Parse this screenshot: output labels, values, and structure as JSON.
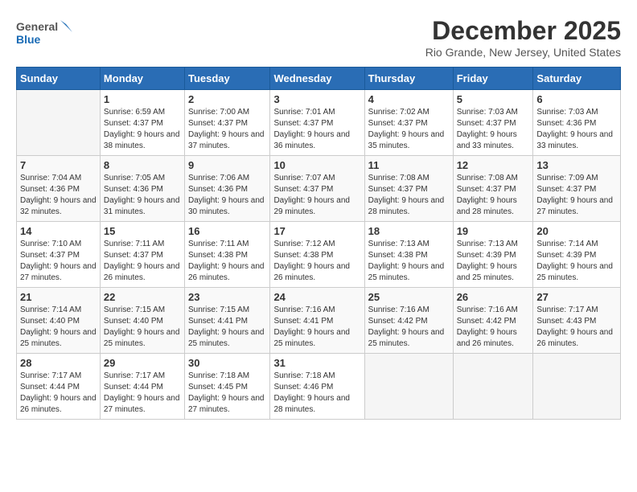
{
  "header": {
    "logo_general": "General",
    "logo_blue": "Blue",
    "month_title": "December 2025",
    "location": "Rio Grande, New Jersey, United States"
  },
  "days_of_week": [
    "Sunday",
    "Monday",
    "Tuesday",
    "Wednesday",
    "Thursday",
    "Friday",
    "Saturday"
  ],
  "weeks": [
    [
      {
        "day": "",
        "sunrise": "",
        "sunset": "",
        "daylight": ""
      },
      {
        "day": "1",
        "sunrise": "Sunrise: 6:59 AM",
        "sunset": "Sunset: 4:37 PM",
        "daylight": "Daylight: 9 hours and 38 minutes."
      },
      {
        "day": "2",
        "sunrise": "Sunrise: 7:00 AM",
        "sunset": "Sunset: 4:37 PM",
        "daylight": "Daylight: 9 hours and 37 minutes."
      },
      {
        "day": "3",
        "sunrise": "Sunrise: 7:01 AM",
        "sunset": "Sunset: 4:37 PM",
        "daylight": "Daylight: 9 hours and 36 minutes."
      },
      {
        "day": "4",
        "sunrise": "Sunrise: 7:02 AM",
        "sunset": "Sunset: 4:37 PM",
        "daylight": "Daylight: 9 hours and 35 minutes."
      },
      {
        "day": "5",
        "sunrise": "Sunrise: 7:03 AM",
        "sunset": "Sunset: 4:37 PM",
        "daylight": "Daylight: 9 hours and 33 minutes."
      },
      {
        "day": "6",
        "sunrise": "Sunrise: 7:03 AM",
        "sunset": "Sunset: 4:36 PM",
        "daylight": "Daylight: 9 hours and 33 minutes."
      }
    ],
    [
      {
        "day": "7",
        "sunrise": "Sunrise: 7:04 AM",
        "sunset": "Sunset: 4:36 PM",
        "daylight": "Daylight: 9 hours and 32 minutes."
      },
      {
        "day": "8",
        "sunrise": "Sunrise: 7:05 AM",
        "sunset": "Sunset: 4:36 PM",
        "daylight": "Daylight: 9 hours and 31 minutes."
      },
      {
        "day": "9",
        "sunrise": "Sunrise: 7:06 AM",
        "sunset": "Sunset: 4:36 PM",
        "daylight": "Daylight: 9 hours and 30 minutes."
      },
      {
        "day": "10",
        "sunrise": "Sunrise: 7:07 AM",
        "sunset": "Sunset: 4:37 PM",
        "daylight": "Daylight: 9 hours and 29 minutes."
      },
      {
        "day": "11",
        "sunrise": "Sunrise: 7:08 AM",
        "sunset": "Sunset: 4:37 PM",
        "daylight": "Daylight: 9 hours and 28 minutes."
      },
      {
        "day": "12",
        "sunrise": "Sunrise: 7:08 AM",
        "sunset": "Sunset: 4:37 PM",
        "daylight": "Daylight: 9 hours and 28 minutes."
      },
      {
        "day": "13",
        "sunrise": "Sunrise: 7:09 AM",
        "sunset": "Sunset: 4:37 PM",
        "daylight": "Daylight: 9 hours and 27 minutes."
      }
    ],
    [
      {
        "day": "14",
        "sunrise": "Sunrise: 7:10 AM",
        "sunset": "Sunset: 4:37 PM",
        "daylight": "Daylight: 9 hours and 27 minutes."
      },
      {
        "day": "15",
        "sunrise": "Sunrise: 7:11 AM",
        "sunset": "Sunset: 4:37 PM",
        "daylight": "Daylight: 9 hours and 26 minutes."
      },
      {
        "day": "16",
        "sunrise": "Sunrise: 7:11 AM",
        "sunset": "Sunset: 4:38 PM",
        "daylight": "Daylight: 9 hours and 26 minutes."
      },
      {
        "day": "17",
        "sunrise": "Sunrise: 7:12 AM",
        "sunset": "Sunset: 4:38 PM",
        "daylight": "Daylight: 9 hours and 26 minutes."
      },
      {
        "day": "18",
        "sunrise": "Sunrise: 7:13 AM",
        "sunset": "Sunset: 4:38 PM",
        "daylight": "Daylight: 9 hours and 25 minutes."
      },
      {
        "day": "19",
        "sunrise": "Sunrise: 7:13 AM",
        "sunset": "Sunset: 4:39 PM",
        "daylight": "Daylight: 9 hours and 25 minutes."
      },
      {
        "day": "20",
        "sunrise": "Sunrise: 7:14 AM",
        "sunset": "Sunset: 4:39 PM",
        "daylight": "Daylight: 9 hours and 25 minutes."
      }
    ],
    [
      {
        "day": "21",
        "sunrise": "Sunrise: 7:14 AM",
        "sunset": "Sunset: 4:40 PM",
        "daylight": "Daylight: 9 hours and 25 minutes."
      },
      {
        "day": "22",
        "sunrise": "Sunrise: 7:15 AM",
        "sunset": "Sunset: 4:40 PM",
        "daylight": "Daylight: 9 hours and 25 minutes."
      },
      {
        "day": "23",
        "sunrise": "Sunrise: 7:15 AM",
        "sunset": "Sunset: 4:41 PM",
        "daylight": "Daylight: 9 hours and 25 minutes."
      },
      {
        "day": "24",
        "sunrise": "Sunrise: 7:16 AM",
        "sunset": "Sunset: 4:41 PM",
        "daylight": "Daylight: 9 hours and 25 minutes."
      },
      {
        "day": "25",
        "sunrise": "Sunrise: 7:16 AM",
        "sunset": "Sunset: 4:42 PM",
        "daylight": "Daylight: 9 hours and 25 minutes."
      },
      {
        "day": "26",
        "sunrise": "Sunrise: 7:16 AM",
        "sunset": "Sunset: 4:42 PM",
        "daylight": "Daylight: 9 hours and 26 minutes."
      },
      {
        "day": "27",
        "sunrise": "Sunrise: 7:17 AM",
        "sunset": "Sunset: 4:43 PM",
        "daylight": "Daylight: 9 hours and 26 minutes."
      }
    ],
    [
      {
        "day": "28",
        "sunrise": "Sunrise: 7:17 AM",
        "sunset": "Sunset: 4:44 PM",
        "daylight": "Daylight: 9 hours and 26 minutes."
      },
      {
        "day": "29",
        "sunrise": "Sunrise: 7:17 AM",
        "sunset": "Sunset: 4:44 PM",
        "daylight": "Daylight: 9 hours and 27 minutes."
      },
      {
        "day": "30",
        "sunrise": "Sunrise: 7:18 AM",
        "sunset": "Sunset: 4:45 PM",
        "daylight": "Daylight: 9 hours and 27 minutes."
      },
      {
        "day": "31",
        "sunrise": "Sunrise: 7:18 AM",
        "sunset": "Sunset: 4:46 PM",
        "daylight": "Daylight: 9 hours and 28 minutes."
      },
      {
        "day": "",
        "sunrise": "",
        "sunset": "",
        "daylight": ""
      },
      {
        "day": "",
        "sunrise": "",
        "sunset": "",
        "daylight": ""
      },
      {
        "day": "",
        "sunrise": "",
        "sunset": "",
        "daylight": ""
      }
    ]
  ]
}
